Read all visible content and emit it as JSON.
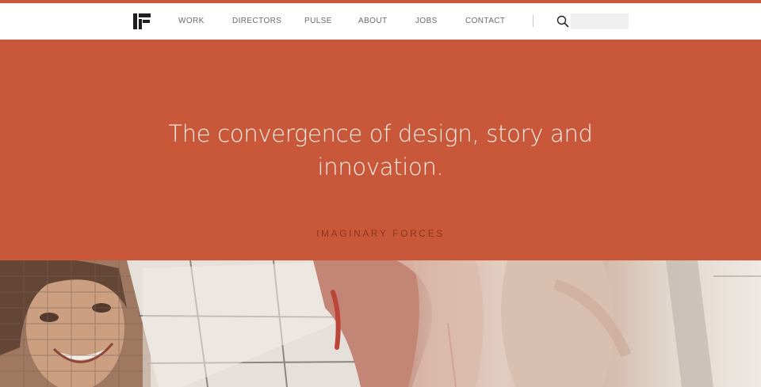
{
  "brand": {
    "logo_icon": "if-logo-icon",
    "accent_color": "#c9573a"
  },
  "nav": {
    "items": [
      {
        "label": "WORK"
      },
      {
        "label": "DIRECTORS"
      },
      {
        "label": "PULSE"
      },
      {
        "label": "ABOUT"
      },
      {
        "label": "JOBS"
      },
      {
        "label": "CONTACT"
      }
    ]
  },
  "search": {
    "icon": "search-icon",
    "value": ""
  },
  "hero": {
    "headline": "The convergence of design, story and innovation.",
    "company": "IMAGINARY FORCES",
    "background_color": "#c9573a"
  },
  "feature_image": {
    "icon": "collage-photo"
  }
}
